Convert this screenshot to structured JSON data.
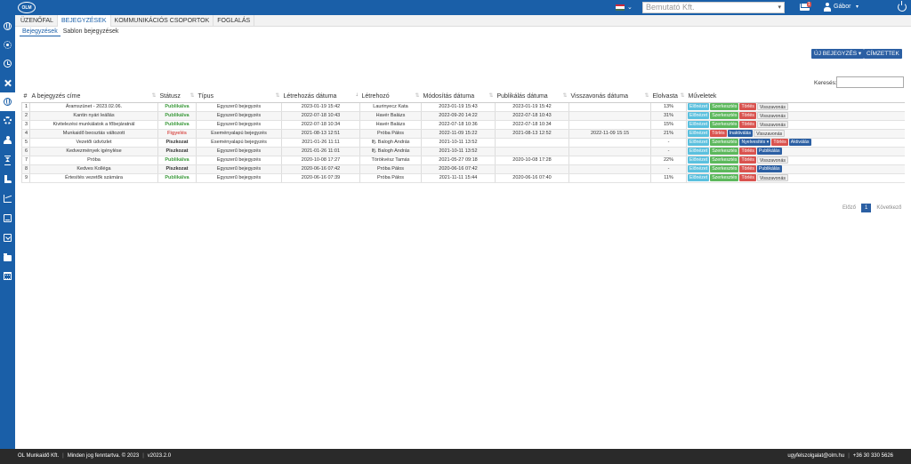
{
  "header": {
    "logo_text": "OLM",
    "company_placeholder": "Bemutató Kft.",
    "mail_count": "1",
    "user_name": "Gábor",
    "colors": {
      "brand": "#1a5fa8",
      "footer": "#2a2a2a"
    }
  },
  "main_tabs": [
    "ÜZENŐFAL",
    "BEJEGYZÉSEK",
    "KOMMUNIKÁCIÓS CSOPORTOK",
    "FOGLALÁS"
  ],
  "sub_tabs": [
    "Bejegyzések",
    "Sablon bejegyzések"
  ],
  "toolbar": {
    "new_entry_label": "ÚJ BEJEGYZÉS",
    "recipients_label": "CÍMZETTEK",
    "search_label": "Keresés:"
  },
  "table": {
    "headers": [
      "#",
      "A bejegyzés címe",
      "Státusz",
      "Típus",
      "Létrehozás dátuma",
      "Létrehozó",
      "Módosítás dátuma",
      "Publikálás dátuma",
      "Visszavonás dátuma",
      "Elolvasta",
      "Műveletek"
    ],
    "rows": [
      {
        "n": "1",
        "title": "Áramszünet - 2023.02.06.",
        "status": "Publikálva",
        "status_kind": "pub",
        "type": "Egyszerű bejegyzés",
        "created": "2023-01-19 15:42",
        "creator": "Laurinyecz Kata",
        "modified": "2023-01-19 15:43",
        "published": "2023-01-19 15:42",
        "revoked": "",
        "read": "13%",
        "actions": [
          "Előnézet",
          "Szerkesztés",
          "Törlés",
          "Visszavonás"
        ]
      },
      {
        "n": "2",
        "title": "Kantin nyári leállás",
        "status": "Publikálva",
        "status_kind": "pub",
        "type": "Egyszerű bejegyzés",
        "created": "2022-07-18 10:43",
        "creator": "Havér Balázs",
        "modified": "2022-09-20 14:22",
        "published": "2022-07-18 10:43",
        "revoked": "",
        "read": "31%",
        "actions": [
          "Előnézet",
          "Szerkesztés",
          "Törlés",
          "Visszavonás"
        ]
      },
      {
        "n": "3",
        "title": "Kivitelezési munkálatok a főbejáratnál",
        "status": "Publikálva",
        "status_kind": "pub",
        "type": "Egyszerű bejegyzés",
        "created": "2022-07-18 10:34",
        "creator": "Havér Balázs",
        "modified": "2022-07-18 10:36",
        "published": "2022-07-18 10:34",
        "revoked": "",
        "read": "15%",
        "actions": [
          "Előnézet",
          "Szerkesztés",
          "Törlés",
          "Visszavonás"
        ]
      },
      {
        "n": "4",
        "title": "Munkaidő beosztás változott",
        "status": "Figyelés",
        "status_kind": "watch",
        "type": "Eseményalapú bejegyzés",
        "created": "2021-08-13 12:51",
        "creator": "Próba Pálos",
        "modified": "2022-11-09 15:22",
        "published": "2021-08-13 12:52",
        "revoked": "2022-11-09 15:15",
        "read": "21%",
        "actions": [
          "Előnézet",
          "Törlés",
          "Inaktiválás",
          "Visszavonás"
        ]
      },
      {
        "n": "5",
        "title": "Vezetői üdvözlet",
        "status": "Piszkozat",
        "status_kind": "draft",
        "type": "Eseményalapú bejegyzés",
        "created": "2021-01-26 11:11",
        "creator": "Ifj. Balogh András",
        "modified": "2021-10-11 13:52",
        "published": "",
        "revoked": "",
        "read": "-",
        "actions": [
          "Előnézet",
          "Szerkesztés",
          "Nyelvesítés ▾",
          "Törlés",
          "Aktiválás"
        ]
      },
      {
        "n": "6",
        "title": "Kedvezmények igénylése",
        "status": "Piszkozat",
        "status_kind": "draft",
        "type": "Egyszerű bejegyzés",
        "created": "2021-01-26 11:01",
        "creator": "Ifj. Balogh András",
        "modified": "2021-10-11 13:52",
        "published": "",
        "revoked": "",
        "read": "-",
        "actions": [
          "Előnézet",
          "Szerkesztés",
          "Törlés",
          "Publikálás"
        ]
      },
      {
        "n": "7",
        "title": "Próba",
        "status": "Publikálva",
        "status_kind": "pub",
        "type": "Egyszerű bejegyzés",
        "created": "2020-10-08 17:27",
        "creator": "Törökvész Tamás",
        "modified": "2021-05-27 09:18",
        "published": "2020-10-08 17:28",
        "revoked": "",
        "read": "22%",
        "actions": [
          "Előnézet",
          "Szerkesztés",
          "Törlés",
          "Visszavonás"
        ]
      },
      {
        "n": "8",
        "title": "Kedves Kolléga",
        "status": "Piszkozat",
        "status_kind": "draft",
        "type": "Egyszerű bejegyzés",
        "created": "2020-06-16 07:42",
        "creator": "Próba Pálos",
        "modified": "2020-06-16 07:42",
        "published": "",
        "revoked": "",
        "read": "-",
        "actions": [
          "Előnézet",
          "Szerkesztés",
          "Törlés",
          "Publikálás"
        ]
      },
      {
        "n": "9",
        "title": "Értesítés vezetők számára",
        "status": "Publikálva",
        "status_kind": "pub",
        "type": "Egyszerű bejegyzés",
        "created": "2020-06-16 07:39",
        "creator": "Próba Pálos",
        "modified": "2021-11-11 15:44",
        "published": "2020-06-16 07:40",
        "revoked": "",
        "read": "11%",
        "actions": [
          "Előnézet",
          "Szerkesztés",
          "Törlés",
          "Visszavonás"
        ]
      }
    ]
  },
  "pager": {
    "prev": "Előző",
    "current": "1",
    "next": "Következő"
  },
  "footer": {
    "company": "OL Munkaidő Kft.",
    "rights": "Minden jog fenntartva. © 2023",
    "version": "v2023.2.0",
    "email": "ugyfelszolgalat@olm.hu",
    "phone": "+36 30 330 5626"
  },
  "sidebar_icons": [
    "globe-icon",
    "sun-icon",
    "clock-icon",
    "tools-icon",
    "link-icon",
    "cogs-icon",
    "users-icon",
    "hourglass-icon",
    "boot-icon",
    "chart-icon",
    "inbox-in-icon",
    "inbox-out-icon",
    "folder-icon",
    "calendar-icon"
  ]
}
